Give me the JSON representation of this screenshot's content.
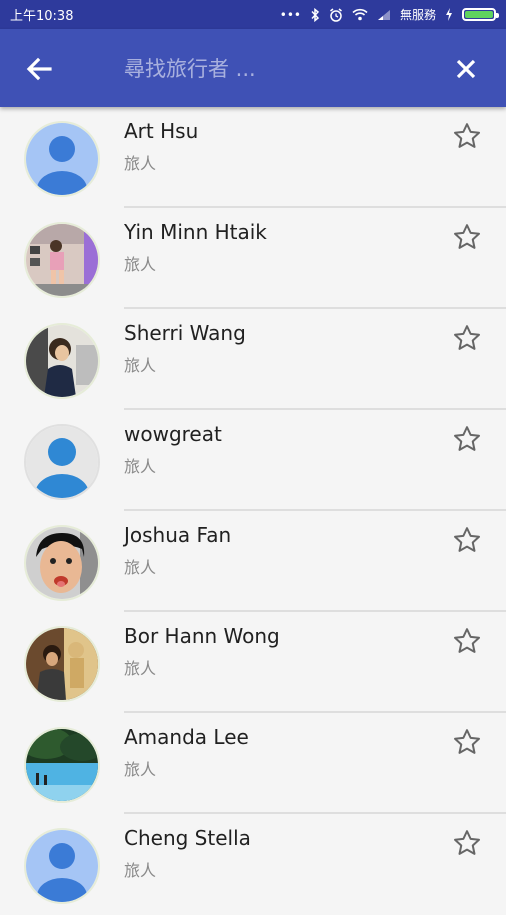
{
  "status_bar": {
    "time": "上午10:38",
    "dots": "•••",
    "carrier": "無服務",
    "icons": [
      "bluetooth-icon",
      "alarm-icon",
      "wifi-icon",
      "signal-icon",
      "charging-icon",
      "battery-icon"
    ]
  },
  "app_bar": {
    "back_icon": "arrow-left-icon",
    "search_placeholder": "尋找旅行者 ...",
    "search_value": "",
    "close_icon": "close-icon",
    "color": "#3f51b5"
  },
  "travelers": [
    {
      "name": "Art Hsu",
      "role": "旅人",
      "avatar": "default-avatar",
      "favorite": false
    },
    {
      "name": "Yin Minn Htaik",
      "role": "旅人",
      "avatar": "photo-avatar",
      "favorite": false
    },
    {
      "name": "Sherri Wang",
      "role": "旅人",
      "avatar": "photo-avatar",
      "favorite": false
    },
    {
      "name": "wowgreat",
      "role": "旅人",
      "avatar": "default-avatar",
      "favorite": false
    },
    {
      "name": "Joshua Fan",
      "role": "旅人",
      "avatar": "photo-avatar",
      "favorite": false
    },
    {
      "name": "Bor Hann Wong",
      "role": "旅人",
      "avatar": "photo-avatar",
      "favorite": false
    },
    {
      "name": "Amanda Lee",
      "role": "旅人",
      "avatar": "photo-avatar",
      "favorite": false
    },
    {
      "name": "Cheng Stella",
      "role": "旅人",
      "avatar": "default-avatar",
      "favorite": false
    }
  ]
}
